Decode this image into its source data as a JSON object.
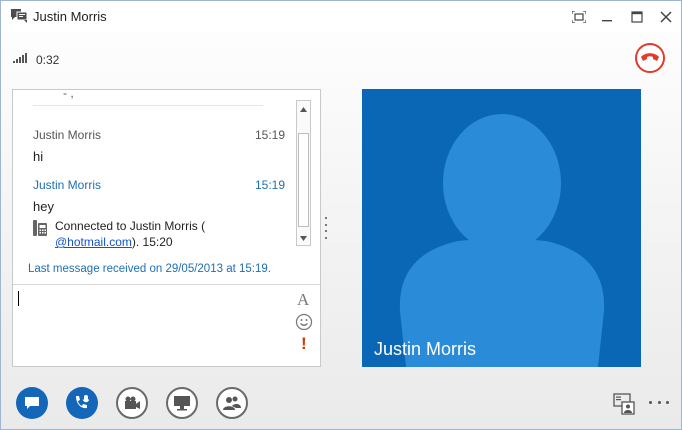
{
  "window": {
    "title": "Justin Morris",
    "controls": [
      "restore-full-screen",
      "minimize",
      "maximize",
      "close"
    ]
  },
  "call": {
    "duration": "0:32",
    "signal_icon": "signal-bars-icon",
    "end_call_icon": "hang-up-icon",
    "end_call_color": "#e23a2b"
  },
  "conversation": {
    "top_fragment": "- ,",
    "messages": [
      {
        "sender": "Justin Morris",
        "time": "15:19",
        "body": "hi",
        "style": "gray"
      },
      {
        "sender": "Justin Morris",
        "time": "15:19",
        "body": "hey",
        "style": "blue"
      }
    ],
    "connection_notice": {
      "text_before": "Connected to Justin Morris (",
      "link": "@hotmail.com",
      "text_after": "). 15:20"
    },
    "last_received": "Last message received on 29/05/2013 at 15:19.",
    "compose": {
      "font_tool": "A",
      "emoticon_icon": "smiley-icon",
      "important_tool": "!"
    }
  },
  "video": {
    "participant_name": "Justin Morris",
    "background": "#0a67b6",
    "avatar_color": "#2a8cd8"
  },
  "toolbar": {
    "buttons": [
      {
        "name": "im-button",
        "icon": "speech-bubble-icon",
        "active": true
      },
      {
        "name": "call-controls-button",
        "icon": "phone-mic-icon",
        "active": true
      },
      {
        "name": "video-button",
        "icon": "video-camera-icon",
        "active": false
      },
      {
        "name": "present-button",
        "icon": "monitor-icon",
        "active": false
      },
      {
        "name": "participants-button",
        "icon": "people-icon",
        "active": false
      }
    ],
    "layout_icon": "conversation-layout-icon",
    "more_icon": "more-options-icon"
  },
  "colors": {
    "accent": "#1466b8",
    "link": "#1155cc",
    "message_blue": "#1f6fb2"
  }
}
